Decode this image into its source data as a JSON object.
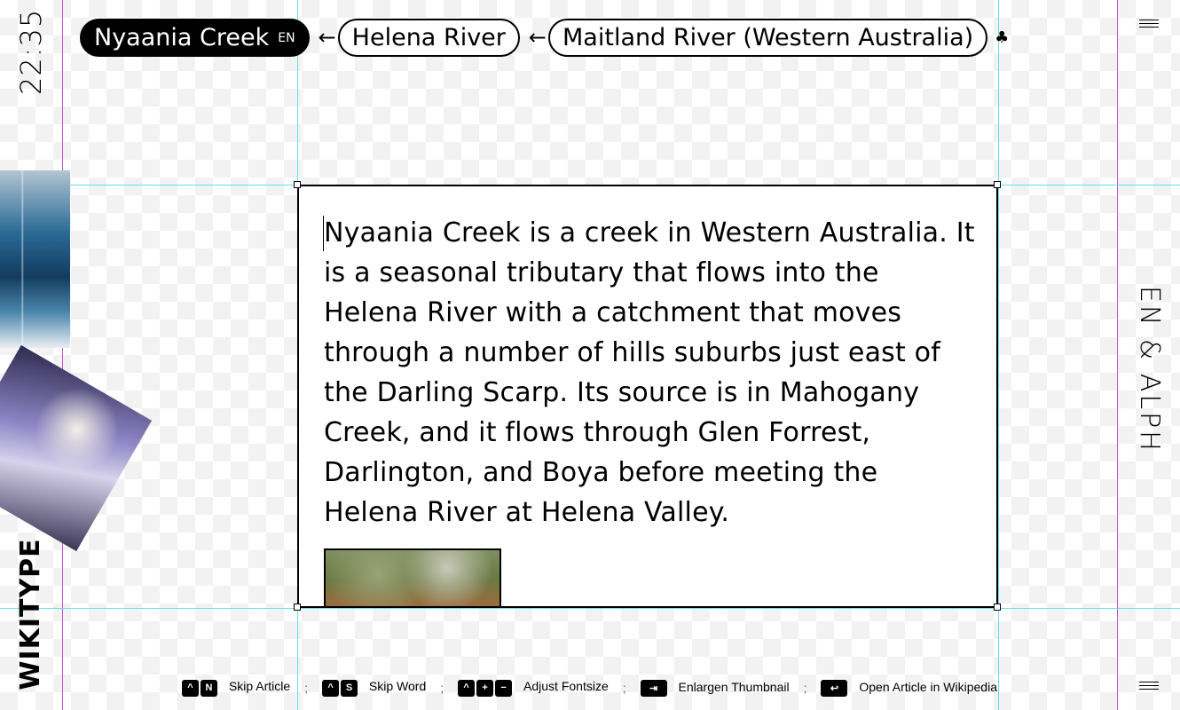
{
  "clock": "22:35",
  "brand": "WIKITYPE",
  "language_label": "EN & ALPH",
  "breadcrumb": {
    "current": "Nyaania Creek",
    "current_lang": "EN",
    "items": [
      "Helena River",
      "Maitland River (Western Australia)"
    ],
    "arrow": "←",
    "more_icon": "cluster-icon"
  },
  "article": {
    "text": "Nyaania Creek is a creek in Western Australia. It is a seasonal tributary that flows into the Helena River with a catchment that moves through a number of hills suburbs just east of the Darling Scarp. Its source is in Mahogany Creek, and it flows through Glen Forrest, Darlington, and Boya before meeting the Helena River at Helena Valley."
  },
  "shortcuts": [
    {
      "keys": [
        "^",
        "N"
      ],
      "label": "Skip Article"
    },
    {
      "keys": [
        "^",
        "S"
      ],
      "label": "Skip Word"
    },
    {
      "keys": [
        "^",
        "+",
        "−"
      ],
      "label": "Adjust Fontsize"
    },
    {
      "keys": [
        "⇥"
      ],
      "label": "Enlargen Thumbnail"
    },
    {
      "keys": [
        "↩"
      ],
      "label": "Open Article in Wikipedia"
    }
  ],
  "separator": ";",
  "colors": {
    "guide_cyan": "#5ee3ee",
    "guide_magenta": "#c64fd1"
  }
}
